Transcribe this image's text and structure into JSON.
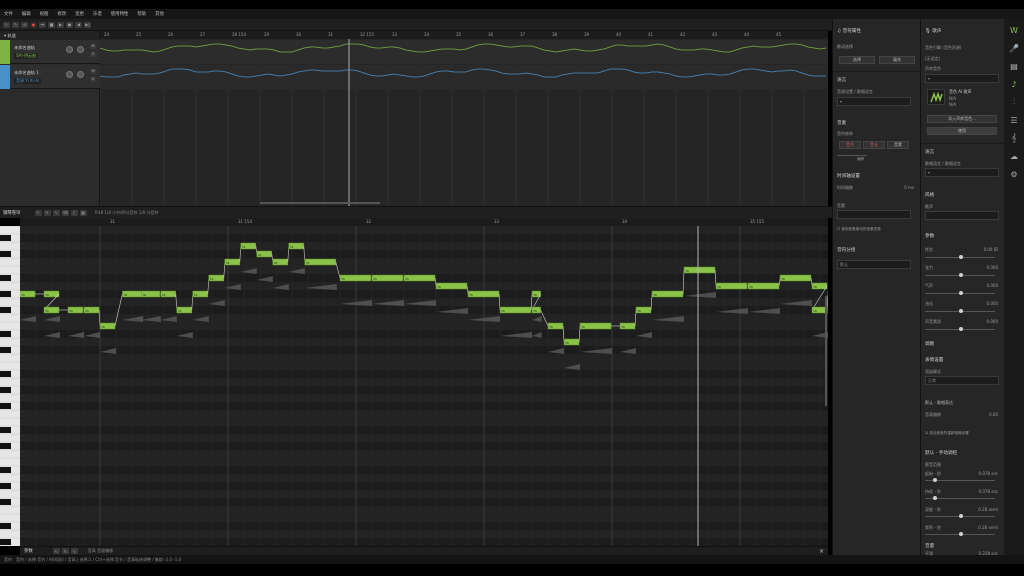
{
  "menu": [
    "文件",
    "编辑",
    "视图",
    "修改",
    "变更",
    "乐谱",
    "使用特性",
    "帮助",
    "其他"
  ],
  "transport": [
    "⏮",
    "■",
    "▶",
    "●",
    "◀",
    "▶|"
  ],
  "tracks": {
    "header_label": "轨道",
    "items": [
      {
        "name": "未命名曲轨",
        "voice": "SP)-明云曲",
        "color": "#7cb342",
        "voice_color": "#7cb342"
      },
      {
        "name": "未命名曲轨 1",
        "voice": "音源 Yi Xi Ai",
        "color": "#4a90c8",
        "voice_color": "#4a90c8"
      }
    ],
    "ruler": [
      "24",
      "25",
      "26",
      "27",
      "28 154",
      "29",
      "30",
      "31",
      "32 155",
      "33",
      "34",
      "35",
      "36",
      "37",
      "38",
      "39",
      "40",
      "41",
      "42",
      "43",
      "44",
      "45"
    ]
  },
  "piano_roll": {
    "title": "钢琴卷帘",
    "info": "Tr48  1/4 小节/四分音符 1/8 分音符",
    "ruler": [
      "31",
      "31 154",
      "32",
      "33",
      "34",
      "35 155"
    ],
    "lyric": "la",
    "notes": [
      {
        "b": 0,
        "l": 1,
        "p": 32
      },
      {
        "b": 1.5,
        "l": 1,
        "p": 32
      },
      {
        "b": 1.5,
        "l": 1,
        "p": 30
      },
      {
        "b": 3,
        "l": 1,
        "p": 30
      },
      {
        "b": 4,
        "l": 1,
        "p": 30
      },
      {
        "b": 5,
        "l": 1,
        "p": 28
      },
      {
        "b": 6.4,
        "l": 1.3,
        "p": 32
      },
      {
        "b": 7.6,
        "l": 1.2,
        "p": 32
      },
      {
        "b": 8.8,
        "l": 1,
        "p": 32
      },
      {
        "b": 9.8,
        "l": 1,
        "p": 30
      },
      {
        "b": 10.8,
        "l": 1,
        "p": 32
      },
      {
        "b": 11.8,
        "l": 1,
        "p": 34
      },
      {
        "b": 12.8,
        "l": 1,
        "p": 36
      },
      {
        "b": 13.8,
        "l": 1,
        "p": 38
      },
      {
        "b": 14.8,
        "l": 1,
        "p": 37
      },
      {
        "b": 15.8,
        "l": 1,
        "p": 36
      },
      {
        "b": 16.8,
        "l": 1,
        "p": 38
      },
      {
        "b": 17.8,
        "l": 2,
        "p": 36
      },
      {
        "b": 20,
        "l": 2,
        "p": 34
      },
      {
        "b": 22,
        "l": 2,
        "p": 34
      },
      {
        "b": 24,
        "l": 2,
        "p": 34
      },
      {
        "b": 26,
        "l": 2,
        "p": 33
      },
      {
        "b": 28,
        "l": 2,
        "p": 32
      },
      {
        "b": 30,
        "l": 2,
        "p": 30
      },
      {
        "b": 32,
        "l": 0.6,
        "p": 32
      },
      {
        "b": 32,
        "l": 0.6,
        "p": 30
      },
      {
        "b": 33,
        "l": 1,
        "p": 28
      },
      {
        "b": 34,
        "l": 1,
        "p": 26
      },
      {
        "b": 35,
        "l": 2,
        "p": 28
      },
      {
        "b": 37.5,
        "l": 1,
        "p": 28
      },
      {
        "b": 38.5,
        "l": 1,
        "p": 30
      },
      {
        "b": 39.5,
        "l": 2,
        "p": 32
      },
      {
        "b": 41.5,
        "l": 2,
        "p": 35
      },
      {
        "b": 43.5,
        "l": 2,
        "p": 33
      },
      {
        "b": 45.5,
        "l": 2,
        "p": 33
      },
      {
        "b": 47.5,
        "l": 2,
        "p": 34
      },
      {
        "b": 49.5,
        "l": 1,
        "p": 33
      },
      {
        "b": 49.5,
        "l": 1,
        "p": 30
      },
      {
        "b": 50.5,
        "l": 1,
        "p": 32
      }
    ]
  },
  "params_bar": {
    "label": "参数",
    "note": "音高  音量偏移"
  },
  "status_text": "音符：音符 / 选择:音节 / 时间段0 / 音高 | 选择:1 / Ctrl+选择:音节 / 音高轨迹调整 / 集群:-2.0 -1.0",
  "panel_a": {
    "title": "音符属性",
    "auto_label": "歌词选择",
    "buttons": [
      "选择",
      "填充"
    ],
    "lang_title": "语言",
    "lang_label": "音源设置 / 歌唱语言",
    "pitch_title": "音素",
    "pitch_label": "音符修饰",
    "pitch_buttons": [
      "音节",
      "音长",
      "音素"
    ],
    "align_label": "偏移",
    "timing_title": "时间轴设置",
    "timing_label": "时间偏移",
    "timing_val": "0 ms",
    "phoneme_title": "音素",
    "checkbox_label": "使用音素驱动的音素发音",
    "group_title": "音符分组",
    "group_val": "默认"
  },
  "panel_b": {
    "title": "歌声",
    "engine_label": "音色引擎 (音色资源)",
    "engine_val": "(无设定)",
    "voice_label": "声库音色",
    "voice_name": "音色 AI 歌声",
    "voice_sub1": "N/A",
    "voice_sub2": "N/A",
    "import_btn": "导入声库音色...",
    "apply_btn": "使用",
    "lang_title": "语言",
    "lang_label": "歌唱语言 / 歌唱语言",
    "style_title": "风格",
    "style_label": "歌声",
    "params_title": "参数",
    "params": [
      {
        "label": "性别",
        "val": "0.00 ID"
      },
      {
        "label": "张力",
        "val": "0.000"
      },
      {
        "label": "气声",
        "val": "0.000"
      },
      {
        "label": "浊化",
        "val": "0.000"
      },
      {
        "label": "声音素质",
        "val": "0.000"
      }
    ],
    "tuning_title": "调教",
    "expr_title": "表情设置",
    "expr_label": "渲染模式",
    "expr_val": "正常",
    "default_label": "默认 - 歌唱表达",
    "pitch_label": "音高偏移",
    "pitch_val": "0.00",
    "checkbox_label": "将全部音符重新粗略设置",
    "manual_title": "默认 - 手动调控",
    "vibrato_title": "颤音范围",
    "vib": [
      {
        "label": "起始 - 秒",
        "val": "0.078 sec"
      },
      {
        "label": "持续 - 秒",
        "val": "0.078 sec"
      },
      {
        "label": "深度 - 秒",
        "val": "0.28 semi"
      },
      {
        "label": "频率 - 秒",
        "val": "0.28 semi"
      }
    ],
    "voice_title": "音量",
    "voice_val": "0.228 sec"
  },
  "side_icons": [
    "logo-icon",
    "mic-icon",
    "film-icon",
    "music-note-icon",
    "library-icon",
    "list-icon",
    "piano-icon",
    "cloud-icon",
    "gear-icon"
  ]
}
